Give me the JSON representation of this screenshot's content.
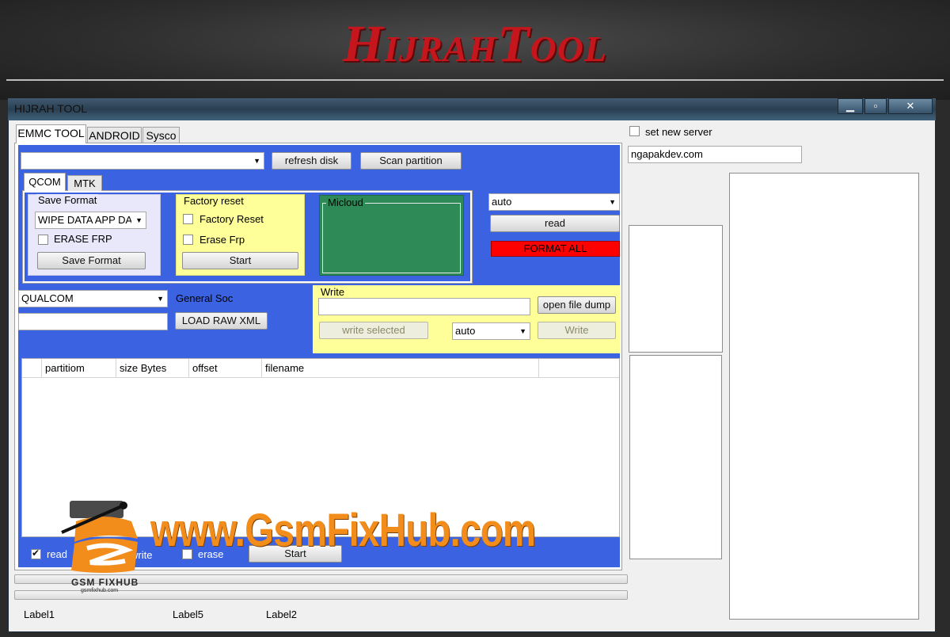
{
  "banner": {
    "title": "HijrahTool"
  },
  "window": {
    "title": "HIJRAH TOOL",
    "min": "▁",
    "max": "▫",
    "close": "✕"
  },
  "tabs": [
    "EMMC TOOL",
    "ANDROID",
    "Sysco"
  ],
  "top_row": {
    "disk_combo": "",
    "refresh_label": "refresh disk",
    "scan_label": "Scan partition"
  },
  "subtabs": [
    "QCOM",
    "MTK"
  ],
  "save_format": {
    "title": "Save Format",
    "mode": "WIPE DATA APP DATA",
    "erase_frp_label": "ERASE FRP",
    "button": "Save Format"
  },
  "factory_reset": {
    "title": "Factory reset",
    "factory_reset_label": "Factory Reset",
    "erase_frp_label": "Erase Frp",
    "button": "Start"
  },
  "micloud": {
    "title": "Micloud"
  },
  "right_controls": {
    "mode": "auto",
    "read_label": "read",
    "format_all_label": "FORMAT ALL"
  },
  "soc": {
    "chip": "QUALCOM",
    "label": "General Soc",
    "xml_path": "",
    "load_xml_label": "LOAD RAW XML"
  },
  "write": {
    "title": "Write",
    "file_path": "",
    "open_dump_label": "open file dump",
    "write_selected_label": "write selected",
    "mode": "auto",
    "write_label": "Write"
  },
  "grid": {
    "columns": [
      "partitiom",
      "size Bytes",
      "offset",
      "filename"
    ]
  },
  "bottom": {
    "read_label": "read",
    "read_checked": true,
    "write_label": "write",
    "write_checked": false,
    "erase_label": "erase",
    "erase_checked": false,
    "start_label": "Start"
  },
  "status": {
    "label1": "Label1",
    "label5": "Label5",
    "label2": "Label2"
  },
  "server": {
    "checkbox_label": "set new server",
    "host": "ngapakdev.com"
  },
  "watermark": {
    "text": "www.GsmFixHub.com",
    "caption": "GSM FIXHUB",
    "url": "gsmfixhub.com"
  },
  "colors": {
    "blue": "#3b62e0",
    "yellow": "#ffff99",
    "green": "#2e8b57",
    "red": "#ff0000",
    "brand": "#c4161c",
    "watermark": "#f28c1a"
  }
}
